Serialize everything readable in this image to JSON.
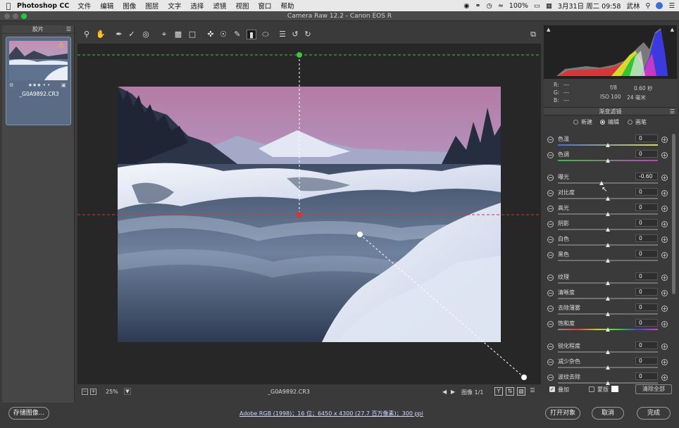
{
  "menubar": {
    "app": "Photoshop CC",
    "items": [
      "文件",
      "编辑",
      "图像",
      "图层",
      "文字",
      "选择",
      "滤镜",
      "视图",
      "窗口",
      "帮助"
    ],
    "battery": "100%",
    "datetime": "3月31日 周二  09:58",
    "user": "武林"
  },
  "window": {
    "title": "Camera Raw 12.2  -  Canon EOS R"
  },
  "filmstrip": {
    "header": "胶片",
    "rating": "★★★ • •",
    "filename": "_G0A9892.CR3"
  },
  "camera_info": {
    "r_label": "R:",
    "r_val": "---",
    "g_label": "G:",
    "g_val": "---",
    "b_label": "B:",
    "b_val": "---",
    "aperture": "f/8",
    "shutter": "0.60 秒",
    "iso": "ISO 100",
    "focal": "24 毫米"
  },
  "panel": {
    "title": "渐变滤镜",
    "modes": [
      "新建",
      "编辑",
      "画笔"
    ],
    "selected_mode": 1,
    "sliders": [
      {
        "label": "色温",
        "value": "0",
        "knob": 0.5,
        "track": "temp"
      },
      {
        "label": "色调",
        "value": "0",
        "knob": 0.5,
        "track": "tint"
      },
      {
        "label": "曝光",
        "value": "-0.60",
        "knob": 0.44,
        "track": "gray"
      },
      {
        "label": "对比度",
        "value": "0",
        "knob": 0.5,
        "track": "gray"
      },
      {
        "label": "高光",
        "value": "0",
        "knob": 0.5,
        "track": "gray"
      },
      {
        "label": "阴影",
        "value": "0",
        "knob": 0.5,
        "track": "gray"
      },
      {
        "label": "白色",
        "value": "0",
        "knob": 0.5,
        "track": "gray"
      },
      {
        "label": "黑色",
        "value": "0",
        "knob": 0.5,
        "track": "gray"
      },
      {
        "label": "纹理",
        "value": "0",
        "knob": 0.5,
        "track": "gray"
      },
      {
        "label": "清晰度",
        "value": "0",
        "knob": 0.5,
        "track": "gray"
      },
      {
        "label": "去除薄雾",
        "value": "0",
        "knob": 0.5,
        "track": "gray"
      },
      {
        "label": "饱和度",
        "value": "0",
        "knob": 0.5,
        "track": "sat"
      },
      {
        "label": "锐化程度",
        "value": "0",
        "knob": 0.5,
        "track": "gray"
      },
      {
        "label": "减少杂色",
        "value": "0",
        "knob": 0.5,
        "track": "gray"
      },
      {
        "label": "波纹去除",
        "value": "0",
        "knob": 0.5,
        "track": "gray"
      }
    ],
    "overlay_label": "叠加",
    "mask_label": "蒙版",
    "clear_all": "清除全部"
  },
  "canvas_bar": {
    "zoom": "25%",
    "filename": "_G0A9892.CR3",
    "image_index": "图像 1/1",
    "y_btn": "Y"
  },
  "statusbar": {
    "save": "存储图像...",
    "info": "Adobe RGB (1998)；16 位；6450 x 4300 (27.7 百万像素)；300 ppi",
    "open": "打开对象",
    "cancel": "取消",
    "done": "完成"
  },
  "colors": {
    "guide_green": "#3ec43e",
    "guide_red": "#e03030",
    "accent": "#7f93b3"
  }
}
